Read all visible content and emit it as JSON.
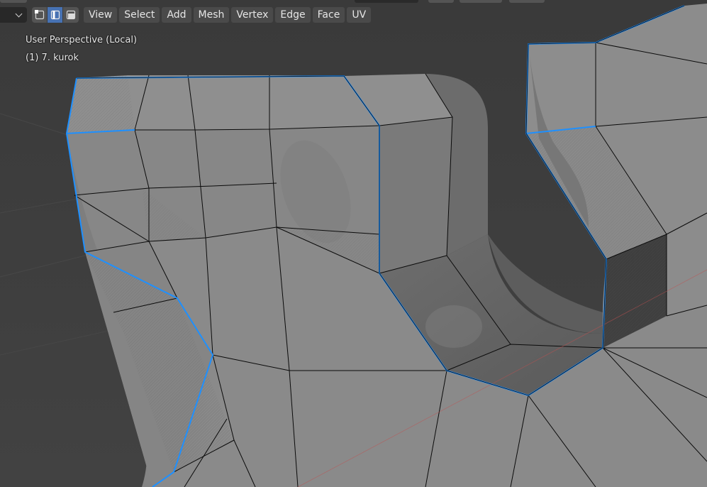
{
  "header": {
    "menus": [
      {
        "label": "View"
      },
      {
        "label": "Select"
      },
      {
        "label": "Add"
      },
      {
        "label": "Mesh"
      },
      {
        "label": "Vertex"
      },
      {
        "label": "Edge"
      },
      {
        "label": "Face"
      },
      {
        "label": "UV"
      }
    ],
    "select_mode": {
      "options": [
        "vertex",
        "edge",
        "face"
      ],
      "active": "edge"
    },
    "mode_dropdown_icon": "chevron-down-icon"
  },
  "viewport": {
    "view_label": "User Perspective (Local)",
    "object_label": "(1) 7. kurok",
    "colors": {
      "background": "#3d3d3d",
      "mesh_face": "#8a8a8a",
      "wire": "#000000",
      "selected_edge": "#1e90ff",
      "x_axis": "#c05050"
    }
  }
}
